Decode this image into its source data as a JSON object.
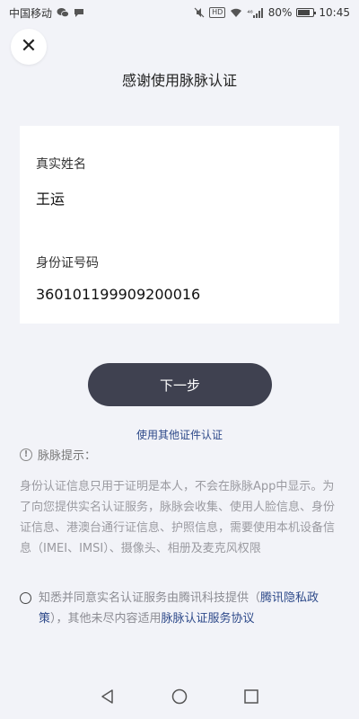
{
  "status_bar": {
    "carrier": "中国移动",
    "hd": "HD",
    "signal": "⁴⁶",
    "battery_percent": 80,
    "battery_text": "80%",
    "time": "10:45"
  },
  "header": {
    "title": "感谢使用脉脉认证"
  },
  "form": {
    "name_label": "真实姓名",
    "name_value": "王运",
    "id_label": "身份证号码",
    "id_value": "360101199909200016"
  },
  "actions": {
    "next_label": "下一步",
    "other_cert_label": "使用其他证件认证"
  },
  "tips": {
    "title": "脉脉提示：",
    "body": "身份认证信息只用于证明是本人，不会在脉脉App中显示。为了向您提供实名认证服务，脉脉会收集、使用人脸信息、身份证信息、港澳台通行证信息、护照信息，需要使用本机设备信息（IMEI、IMSI）、摄像头、相册及麦克风权限"
  },
  "agreement": {
    "text_1": "知悉并同意实名认证服务由腾讯科技提供（",
    "link_privacy": "腾讯隐私政策",
    "text_2": "），其他未尽内容适用",
    "link_service": "脉脉认证服务协议"
  },
  "icons": {
    "close": "close-icon",
    "info": "info-icon",
    "back": "back-triangle-icon",
    "home": "home-circle-icon",
    "recent": "recent-square-icon"
  }
}
